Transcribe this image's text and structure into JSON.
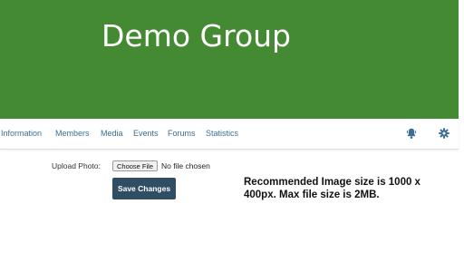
{
  "banner": {
    "title": "Demo Group",
    "color": "#448a33"
  },
  "nav": {
    "items": [
      {
        "label": "Information"
      },
      {
        "label": "Members"
      },
      {
        "label": "Media"
      },
      {
        "label": "Events"
      },
      {
        "label": "Forums"
      },
      {
        "label": "Statistics"
      }
    ],
    "link_color": "#3b6f93",
    "icons": [
      "bell-icon",
      "gear-icon"
    ]
  },
  "form": {
    "upload_label": "Upload Photo:",
    "file_button_label": "Choose File",
    "file_status": "No file chosen",
    "save_label": "Save Changes",
    "save_color": "#2f4d63"
  },
  "note": {
    "text": "Recommended Image size is 1000 x 400px. Max file size is 2MB."
  }
}
